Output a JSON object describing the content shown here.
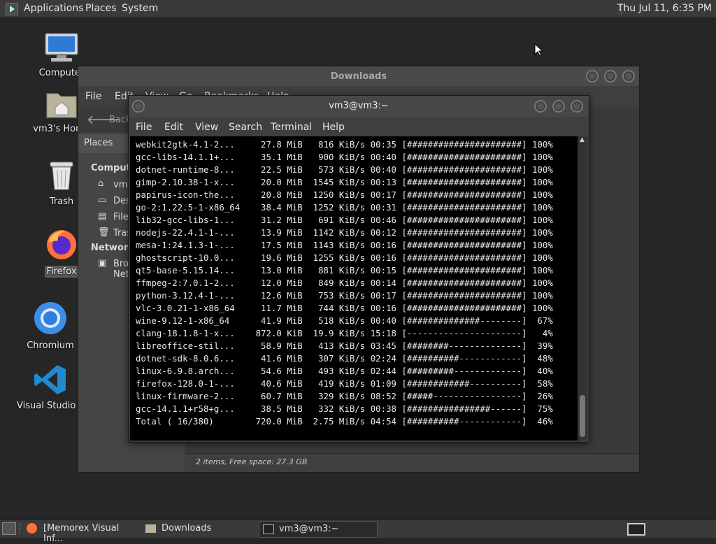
{
  "top_panel": {
    "menus": [
      "Applications",
      "Places",
      "System"
    ],
    "clock": "Thu Jul 11,  6:35 PM"
  },
  "desktop": {
    "icons": [
      "Computer",
      "vm3's Home",
      "Trash",
      "Firefox",
      "Chromium",
      "Visual Studio Code"
    ]
  },
  "file_manager": {
    "title": "Downloads",
    "menu": [
      "File",
      "Edit",
      "View",
      "Go",
      "Bookmarks",
      "Help"
    ],
    "back_label": "Back",
    "sidebar": {
      "heading": "Places",
      "computer_label": "Computer",
      "items": [
        "vm3",
        "Desktop",
        "File System",
        "Trash"
      ],
      "network_label": "Network",
      "network_items": [
        "Browse Network"
      ]
    },
    "status": "2 items, Free space: 27.3 GB"
  },
  "terminal": {
    "title": "vm3@vm3:~",
    "menu": [
      "File",
      "Edit",
      "View",
      "Search",
      "Terminal",
      "Help"
    ],
    "lines": [
      "webkit2gtk-4.1-2...     27.8 MiB   816 KiB/s 00:35 [######################] 100%",
      "gcc-libs-14.1.1+...     35.1 MiB   900 KiB/s 00:40 [######################] 100%",
      "dotnet-runtime-8...     22.5 MiB   573 KiB/s 00:40 [######################] 100%",
      "gimp-2.10.38-1-x...     20.0 MiB  1545 KiB/s 00:13 [######################] 100%",
      "papirus-icon-the...     20.8 MiB  1250 KiB/s 00:17 [######################] 100%",
      "go-2:1.22.5-1-x86_64    38.4 MiB  1252 KiB/s 00:31 [######################] 100%",
      "lib32-gcc-libs-1...     31.2 MiB   691 KiB/s 00:46 [######################] 100%",
      "nodejs-22.4.1-1-...     13.9 MiB  1142 KiB/s 00:12 [######################] 100%",
      "mesa-1:24.1.3-1-...     17.5 MiB  1143 KiB/s 00:16 [######################] 100%",
      "ghostscript-10.0...     19.6 MiB  1255 KiB/s 00:16 [######################] 100%",
      "qt5-base-5.15.14...     13.0 MiB   881 KiB/s 00:15 [######################] 100%",
      "ffmpeg-2:7.0.1-2...     12.0 MiB   849 KiB/s 00:14 [######################] 100%",
      "python-3.12.4-1-...     12.6 MiB   753 KiB/s 00:17 [######################] 100%",
      "vlc-3.0.21-1-x86_64     11.7 MiB   744 KiB/s 00:16 [######################] 100%",
      "wine-9.12-1-x86_64      41.9 MiB   518 KiB/s 00:40 [##############--------]  67%",
      "clang-18.1.8-1-x...    872.0 KiB  19.9 KiB/s 15:18 [----------------------]   4%",
      "libreoffice-stil...     58.9 MiB   413 KiB/s 03:45 [########--------------]  39%",
      "dotnet-sdk-8.0.6...     41.6 MiB   307 KiB/s 02:24 [##########------------]  48%",
      "linux-6.9.8.arch...     54.6 MiB   493 KiB/s 02:44 [#########-------------]  40%",
      "firefox-128.0-1-...     40.6 MiB   419 KiB/s 01:09 [############----------]  58%",
      "linux-firmware-2...     60.7 MiB   329 KiB/s 08:52 [#####-----------------]  26%",
      "gcc-14.1.1+r58+g...     38.5 MiB   332 KiB/s 00:38 [################------]  75%",
      "Total ( 16/380)        720.0 MiB  2.75 MiB/s 04:54 [##########------------]  46%"
    ]
  },
  "taskbar": {
    "tasks": [
      "[Memorex Visual Inf...",
      "Downloads",
      "vm3@vm3:~"
    ]
  }
}
